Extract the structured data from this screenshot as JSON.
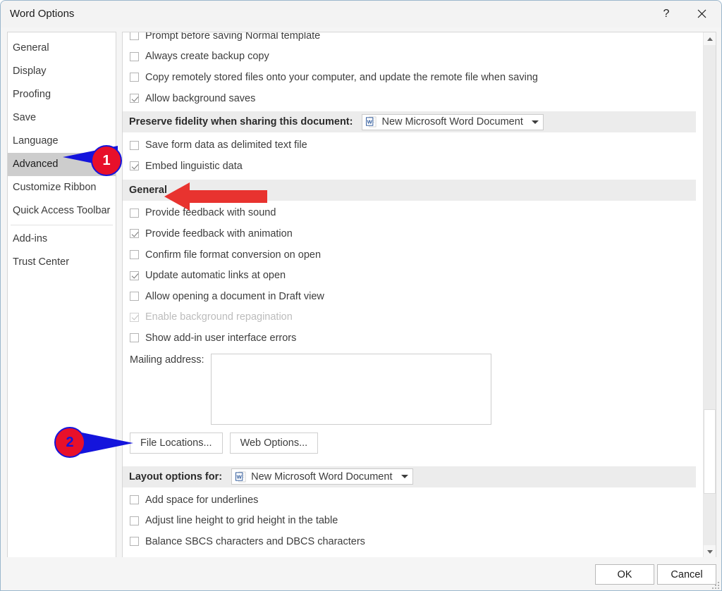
{
  "window": {
    "title": "Word Options",
    "help_icon": "question-mark-icon",
    "close_icon": "close-icon"
  },
  "sidebar": {
    "items": [
      {
        "label": "General",
        "selected": false
      },
      {
        "label": "Display",
        "selected": false
      },
      {
        "label": "Proofing",
        "selected": false
      },
      {
        "label": "Save",
        "selected": false
      },
      {
        "label": "Language",
        "selected": false
      },
      {
        "label": "Advanced",
        "selected": true
      },
      {
        "label": "Customize Ribbon",
        "selected": false
      },
      {
        "label": "Quick Access Toolbar",
        "selected": false
      },
      {
        "label": "Add-ins",
        "selected": false
      },
      {
        "label": "Trust Center",
        "selected": false
      }
    ]
  },
  "content": {
    "clipped_top_row": {
      "label": "Prompt before saving Normal template",
      "checked": false
    },
    "save_options": [
      {
        "label": "Always create backup copy",
        "checked": false,
        "mnemonic": "b"
      },
      {
        "label": "Copy remotely stored files onto your computer, and update the remote file when saving",
        "checked": false,
        "mnemonic": "e"
      },
      {
        "label": "Allow background saves",
        "checked": true,
        "mnemonic": "A"
      }
    ],
    "preserve_fidelity": {
      "header": "Preserve fidelity when sharing this document:",
      "header_mnemonic": "d",
      "combo_value": "New Microsoft Word Document",
      "combo_icon": "word-document-icon",
      "caret_icon": "chevron-down-icon",
      "options": [
        {
          "label": "Save form data as delimited text file",
          "checked": false,
          "mnemonic": "d"
        },
        {
          "label": "Embed linguistic data",
          "checked": true,
          "mnemonic": "u"
        }
      ]
    },
    "general": {
      "header": "General",
      "options": [
        {
          "label": "Provide feedback with sound",
          "checked": false,
          "disabled": false,
          "mnemonic": "s"
        },
        {
          "label": "Provide feedback with animation",
          "checked": true,
          "disabled": false,
          "mnemonic": "a"
        },
        {
          "label": "Confirm file format conversion on open",
          "checked": false,
          "disabled": false,
          "mnemonic": "v"
        },
        {
          "label": "Update automatic links at open",
          "checked": true,
          "disabled": false,
          "mnemonic": "u"
        },
        {
          "label": "Allow opening a document in Draft view",
          "checked": false,
          "disabled": false,
          "mnemonic": "D"
        },
        {
          "label": "Enable background repagination",
          "checked": true,
          "disabled": true,
          "mnemonic": "b"
        },
        {
          "label": "Show add-in user interface errors",
          "checked": false,
          "disabled": false,
          "mnemonic": "u"
        }
      ],
      "mailing_address_label": "Mailing address:",
      "mailing_address_value": "",
      "file_locations_button": "File Locations...",
      "web_options_button": "Web Options..."
    },
    "layout_options": {
      "header": "Layout options for:",
      "combo_value": "New Microsoft Word Document",
      "combo_icon": "word-document-icon",
      "caret_icon": "chevron-down-icon",
      "options": [
        {
          "label": "Add space for underlines",
          "checked": false,
          "mnemonic": "s"
        },
        {
          "label": "Adjust line height to grid height in the table",
          "checked": false,
          "mnemonic": "l"
        },
        {
          "label": "Balance SBCS characters and DBCS characters",
          "checked": false,
          "mnemonic": "S"
        }
      ]
    }
  },
  "scrollbar": {
    "up_arrow_icon": "scroll-up-arrow-icon",
    "down_arrow_icon": "scroll-down-arrow-icon"
  },
  "footer": {
    "ok_label": "OK",
    "cancel_label": "Cancel"
  },
  "annotations": {
    "callout_1": "1",
    "callout_2": "2",
    "arrow_general": "red-left-arrow",
    "colors": {
      "callout_red": "#e8102a",
      "callout_blue": "#1414dc",
      "arrow_red": "#e8332f"
    }
  }
}
